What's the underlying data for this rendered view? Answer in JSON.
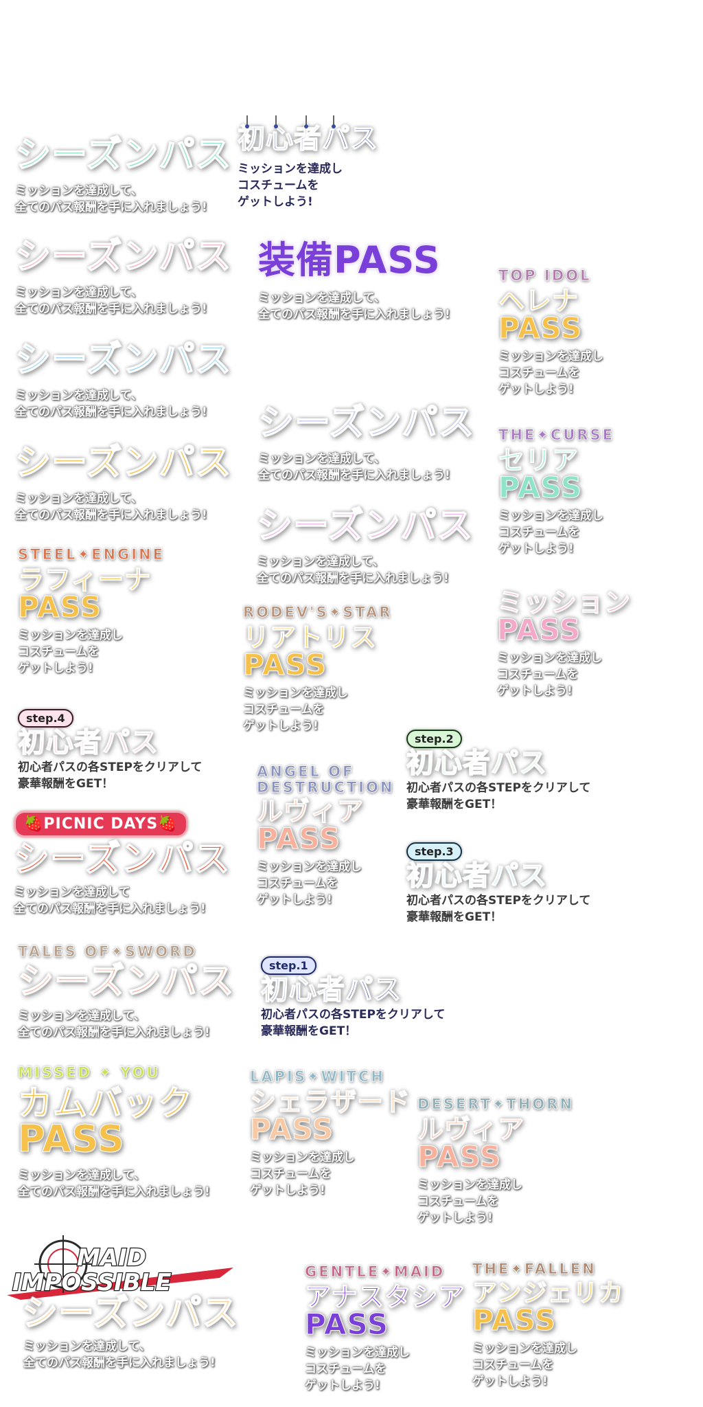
{
  "texts": {
    "season_pass": "シーズンパス",
    "pass": "PASS",
    "beginner_pass": "初心者パス",
    "equip_pass": "装備PASS",
    "desc_season_1": "ミッションを達成して、",
    "desc_season_2": "全てのパス報酬を手に入れましょう!",
    "desc_season_1b": "ミッションを達成して",
    "desc_costume_1": "ミッションを達成し",
    "desc_costume_2": "コスチュームを",
    "desc_costume_3": "ゲットしよう!",
    "desc_step_1": "初心者パスの各STEPをクリアして",
    "desc_step_2": "豪華報酬をGET！"
  },
  "subtitles": {
    "top_idol": "TOP IDOL",
    "the_curse": "THE✦CURSE",
    "steel_engine": "STEEL✦ENGINE",
    "rodevs_star": "RODEV'S✦STAR",
    "angel_1": "ANGEL OF",
    "angel_2": "DESTRUCTION",
    "tales_of_sword": "TALES OF✦SWORD",
    "missed_you": "MISSED ✦ YOU",
    "lapis_witch": "LAPIS✦WITCH",
    "desert_thorn": "DESERT✦THORN",
    "gentle_maid": "GENTLE✦MAID",
    "the_fallen": "THE✦FALLEN",
    "maid_1": "MAID",
    "maid_2": "IMPOSSIBLE"
  },
  "names": {
    "helena": "ヘレナ",
    "seria": "セリア",
    "mission": "ミッション",
    "rafina": "ラフィーナ",
    "riatris": "リアトリス",
    "luvia": "ルヴィア",
    "comeback": "カムバック",
    "sherazade": "シェラザード",
    "anastasia": "アナスタシア",
    "angelica": "アンジェリカ"
  },
  "badges": {
    "step1": "step.1",
    "step2": "step.2",
    "step3": "step.3",
    "step4": "step.4",
    "picnic": "🍓PICNIC DAYS🍓"
  },
  "colors": {
    "mint": "#8fe3c9",
    "pink": "#f4b4c4",
    "sky": "#9fd8f2",
    "gold": "#f5c14a",
    "lavender": "#c2c9ee",
    "lilac": "#f3b4ea",
    "purple": "#7a3fd8",
    "navy": "#3a4a9c",
    "coral": "#ef5a3e",
    "peach": "#f5b8a4",
    "green": "#bff0c0",
    "ice": "#b7e7f6",
    "rust": "#c9573d"
  }
}
